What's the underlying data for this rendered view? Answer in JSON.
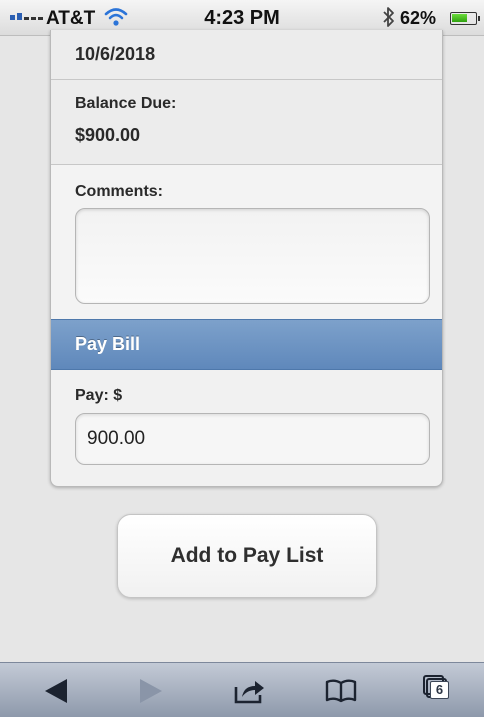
{
  "status_bar": {
    "carrier": "AT&T",
    "time": "4:23 PM",
    "battery_percent": "62%",
    "battery_level": 0.62,
    "icons": [
      "signal-icon",
      "wifi-icon",
      "bluetooth-icon",
      "battery-icon"
    ]
  },
  "bill": {
    "date": "10/6/2018",
    "balance_label": "Balance Due:",
    "balance_value": "$900.00",
    "comments_label": "Comments:",
    "comments_value": ""
  },
  "pay_section": {
    "header": "Pay Bill",
    "pay_label": "Pay: $",
    "pay_value": "900.00"
  },
  "actions": {
    "add_label": "Add to Pay List"
  },
  "toolbar": {
    "tabs_count": "6",
    "icons": [
      "back-arrow-icon",
      "forward-arrow-icon",
      "share-icon",
      "bookmarks-icon",
      "tabs-icon"
    ]
  },
  "colors": {
    "accent_bar": "#6a91c2",
    "toolbar": "#a6afbd"
  }
}
